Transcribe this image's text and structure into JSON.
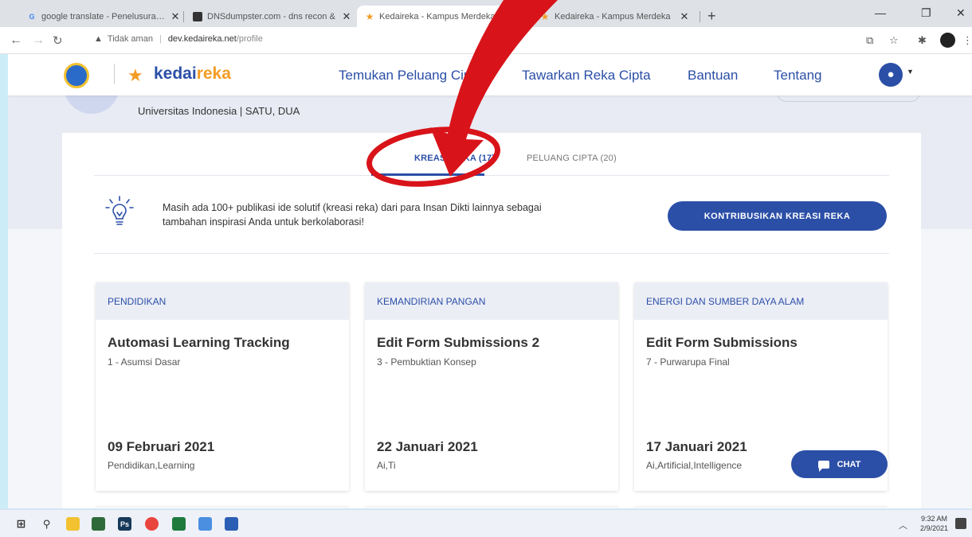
{
  "browser": {
    "tabs": [
      {
        "label": "google translate - Penelusuran G",
        "favicon": "G",
        "active": false
      },
      {
        "label": "DNSdumpster.com - dns recon &",
        "favicon": "dns-icon",
        "active": false
      },
      {
        "label": "Kedaireka - Kampus Merdeka",
        "favicon": "star-icon",
        "active": true
      },
      {
        "label": "Kedaireka - Kampus Merdeka",
        "favicon": "star-icon",
        "active": false
      }
    ],
    "security_label": "Tidak aman",
    "url_host": "dev.kedaireka.net",
    "url_path": "/profile"
  },
  "header": {
    "logo_prefix": "kedai",
    "logo_accent": "reka",
    "nav": [
      "Temukan Peluang Cipta",
      "Tawarkan Reka Cipta",
      "Bantuan",
      "Tentang"
    ]
  },
  "profile": {
    "university": "Universitas Indonesia | SATU, DUA"
  },
  "tabs": {
    "kreasi": "KREASI REKA (17)",
    "peluang": "PELUANG CIPTA (20)"
  },
  "info": {
    "text": "Masih ada 100+ publikasi ide solutif (kreasi reka) dari para Insan Dikti lainnya sebagai tambahan inspirasi Anda untuk berkolaborasi!",
    "button": "KONTRIBUSIKAN KREASI REKA"
  },
  "cards": [
    {
      "category": "PENDIDIKAN",
      "title": "Automasi Learning Tracking",
      "stage": "1 - Asumsi Dasar",
      "date": "09 Februari 2021",
      "tags": "Pendidikan,Learning"
    },
    {
      "category": "KEMANDIRIAN PANGAN",
      "title": "Edit Form Submissions 2",
      "stage": "3 - Pembuktian Konsep",
      "date": "22 Januari 2021",
      "tags": "Ai,Ti"
    },
    {
      "category": "ENERGI DAN SUMBER DAYA ALAM",
      "title": "Edit Form Submissions",
      "stage": "7 - Purwarupa Final",
      "date": "17 Januari 2021",
      "tags": "Ai,Artificial,Intelligence"
    }
  ],
  "chat": {
    "label": "CHAT"
  },
  "taskbar": {
    "time": "9:32 AM",
    "date": "2/9/2021"
  },
  "colors": {
    "brand_blue": "#2b4fa7",
    "brand_orange": "#f39c24",
    "annotation_red": "#d8141a"
  }
}
